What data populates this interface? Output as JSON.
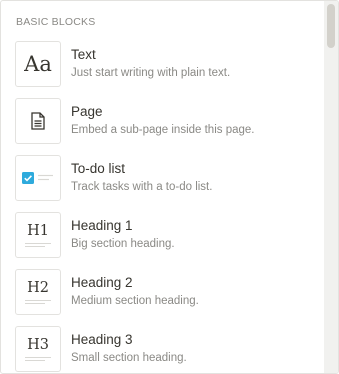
{
  "section": {
    "header": "BASIC BLOCKS"
  },
  "items": [
    {
      "title": "Text",
      "description": "Just start writing with plain text.",
      "icon": "text-aa-icon",
      "glyph": "Aa"
    },
    {
      "title": "Page",
      "description": "Embed a sub-page inside this page.",
      "icon": "page-document-icon"
    },
    {
      "title": "To-do list",
      "description": "Track tasks with a to-do list.",
      "icon": "checkbox-icon"
    },
    {
      "title": "Heading 1",
      "description": "Big section heading.",
      "icon": "heading1-icon",
      "glyph": "H1"
    },
    {
      "title": "Heading 2",
      "description": "Medium section heading.",
      "icon": "heading2-icon",
      "glyph": "H2"
    },
    {
      "title": "Heading 3",
      "description": "Small section heading.",
      "icon": "heading3-icon",
      "glyph": "H3"
    }
  ],
  "colors": {
    "accent": "#2eaadc",
    "border": "#e3e2df",
    "muted": "#8a8985",
    "text": "#37352f"
  }
}
